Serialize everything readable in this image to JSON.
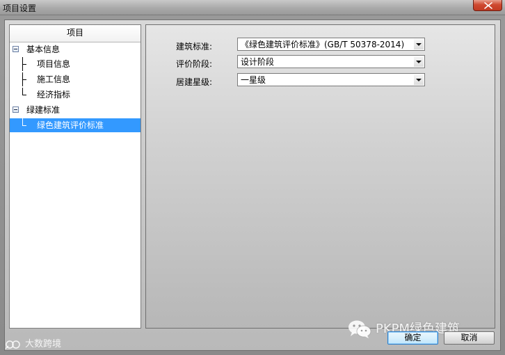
{
  "window": {
    "title": "项目设置",
    "close_icon": "close-icon"
  },
  "tree": {
    "header": "项目",
    "nodes": [
      {
        "label": "基本信息",
        "expanded": true
      },
      {
        "label": "项目信息"
      },
      {
        "label": "施工信息"
      },
      {
        "label": "经济指标"
      },
      {
        "label": "绿建标准",
        "expanded": true
      },
      {
        "label": "绿色建筑评价标准",
        "selected": true
      }
    ]
  },
  "form": {
    "fields": [
      {
        "label": "建筑标准:",
        "value": "《绿色建筑评价标准》(GB/T 50378-2014)"
      },
      {
        "label": "评价阶段:",
        "value": "设计阶段"
      },
      {
        "label": "居建星级:",
        "value": "一星级"
      }
    ]
  },
  "buttons": {
    "ok": "确定",
    "cancel": "取消"
  },
  "watermarks": {
    "right": "PKPM绿色建筑",
    "left": "大数跨境"
  },
  "colors": {
    "selection": "#3399ff",
    "close_button": "#c13a22"
  }
}
